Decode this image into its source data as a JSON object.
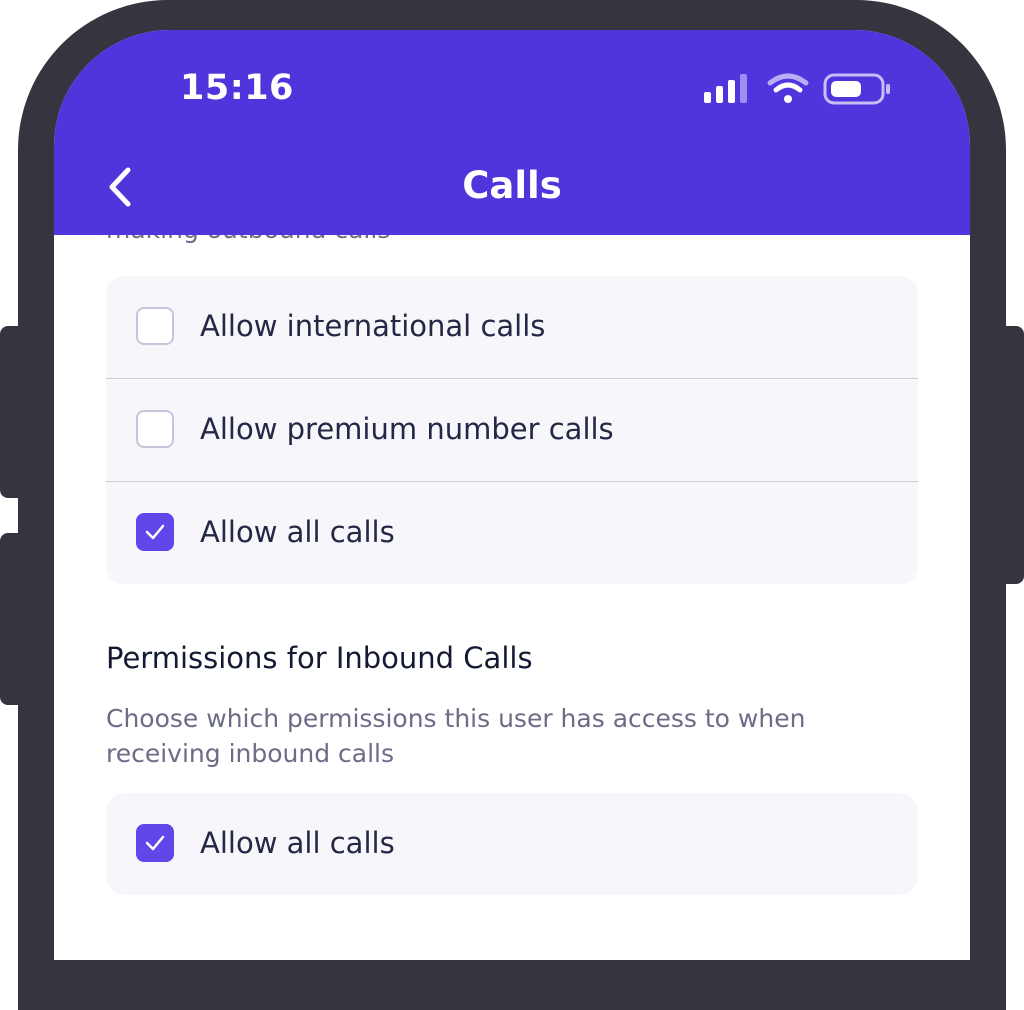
{
  "status_bar": {
    "time": "15:16"
  },
  "header": {
    "title": "Calls",
    "back_icon": "chevron-left-icon"
  },
  "outbound": {
    "description_clipped": "making outbound calls",
    "options": [
      {
        "label": "Allow international calls",
        "checked": false
      },
      {
        "label": "Allow premium number calls",
        "checked": false
      },
      {
        "label": "Allow all calls",
        "checked": true
      }
    ]
  },
  "inbound": {
    "title": "Permissions for Inbound Calls",
    "description": "Choose which permissions this user has access to when receiving inbound calls",
    "options": [
      {
        "label": "Allow all calls",
        "checked": true
      }
    ]
  },
  "colors": {
    "accent": "#5234dd",
    "checkbox_checked": "#6246ea",
    "frame": "#35343f",
    "card_bg": "#f6f6fb"
  }
}
